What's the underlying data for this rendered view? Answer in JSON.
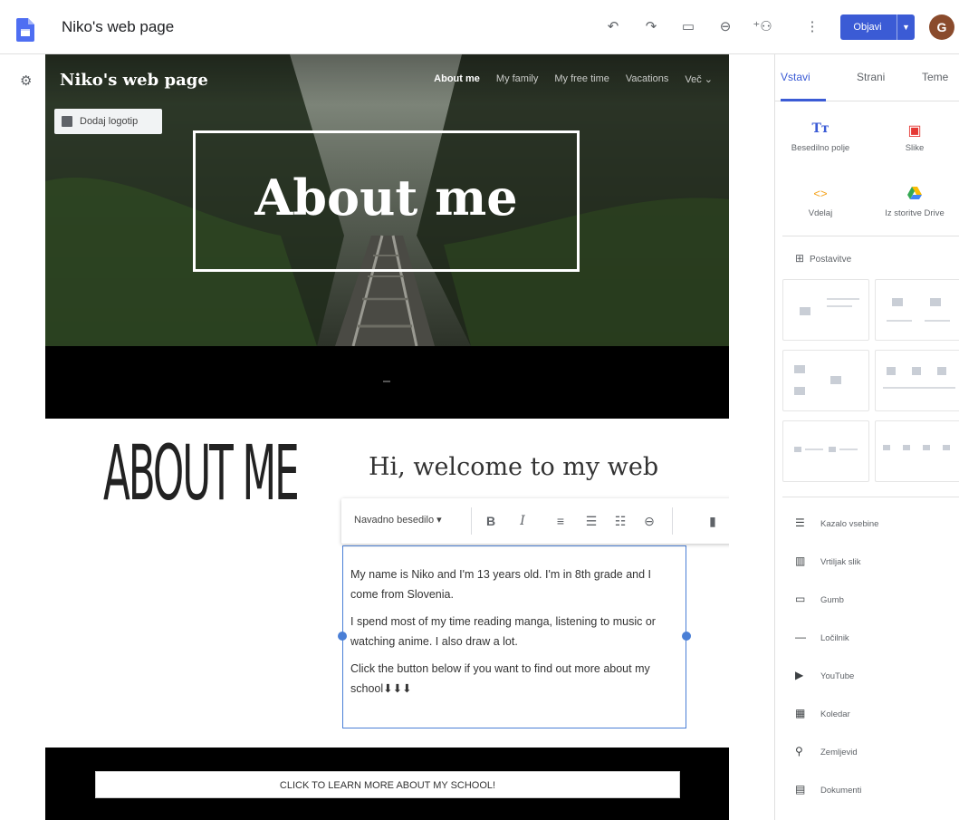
{
  "app": {
    "site_title": "Niko's web page",
    "publish_label": "Objavi",
    "avatar_letter": "G"
  },
  "site": {
    "brand": "Niko's web page",
    "nav": [
      "About me",
      "My family",
      "My free time",
      "Vacations",
      "Več ⌄"
    ],
    "add_logo": "Dodaj logotip",
    "hero_title": "About me",
    "about_heading": "ABOUT ME",
    "welcome": "Hi, welcome to my web",
    "paragraphs": [
      "My name is Niko and I'm 13 years old. I'm in 8th grade and I come from Slovenia.",
      "I spend most of my time reading manga, listening to music or watching anime. I also draw a lot.",
      "Click the button below if you want to find out more about my school⬇⬇⬇"
    ],
    "school_button": "CLICK TO LEARN MORE ABOUT MY SCHOOL!"
  },
  "format_bar": {
    "style_label": "Navadno besedilo"
  },
  "panel": {
    "tabs": [
      "Vstavi",
      "Strani",
      "Teme"
    ],
    "insert": [
      {
        "label": "Besedilno polje",
        "icon": "text-box-icon"
      },
      {
        "label": "Slike",
        "icon": "image-icon"
      },
      {
        "label": "Vdelaj",
        "icon": "embed-icon"
      },
      {
        "label": "Iz storitve Drive",
        "icon": "drive-icon"
      }
    ],
    "layouts_label": "Postavitve",
    "components": [
      "Kazalo vsebine",
      "Vrtiljak slik",
      "Gumb",
      "Ločilnik",
      "YouTube",
      "Koledar",
      "Zemljevid",
      "Dokumenti"
    ]
  },
  "colors": {
    "accent": "#3b5bd5",
    "selection": "#4a7fd6"
  }
}
